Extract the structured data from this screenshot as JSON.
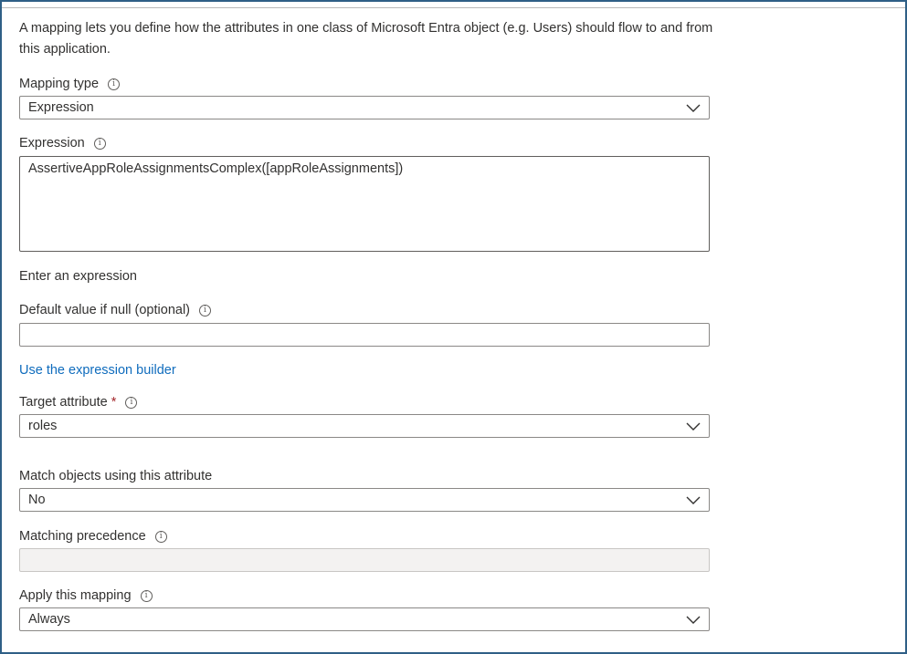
{
  "description": "A mapping lets you define how the attributes in one class of Microsoft Entra object (e.g. Users) should flow to and from this application.",
  "mapping_type": {
    "label": "Mapping type",
    "value": "Expression"
  },
  "expression": {
    "label": "Expression",
    "value": "AssertiveAppRoleAssignmentsComplex([appRoleAssignments])",
    "hint": "Enter an expression"
  },
  "default_value": {
    "label": "Default value if null (optional)",
    "value": ""
  },
  "expression_builder_link": "Use the expression builder",
  "target_attribute": {
    "label": "Target attribute",
    "required_mark": "*",
    "value": "roles"
  },
  "match_objects": {
    "label": "Match objects using this attribute",
    "value": "No"
  },
  "matching_precedence": {
    "label": "Matching precedence",
    "value": ""
  },
  "apply_mapping": {
    "label": "Apply this mapping",
    "value": "Always"
  },
  "icons": {
    "info": "info-icon",
    "dropdown": "chevron-down-icon"
  },
  "colors": {
    "link": "#0f6cbd",
    "required": "#a4262c",
    "frame": "#2f5f86"
  }
}
